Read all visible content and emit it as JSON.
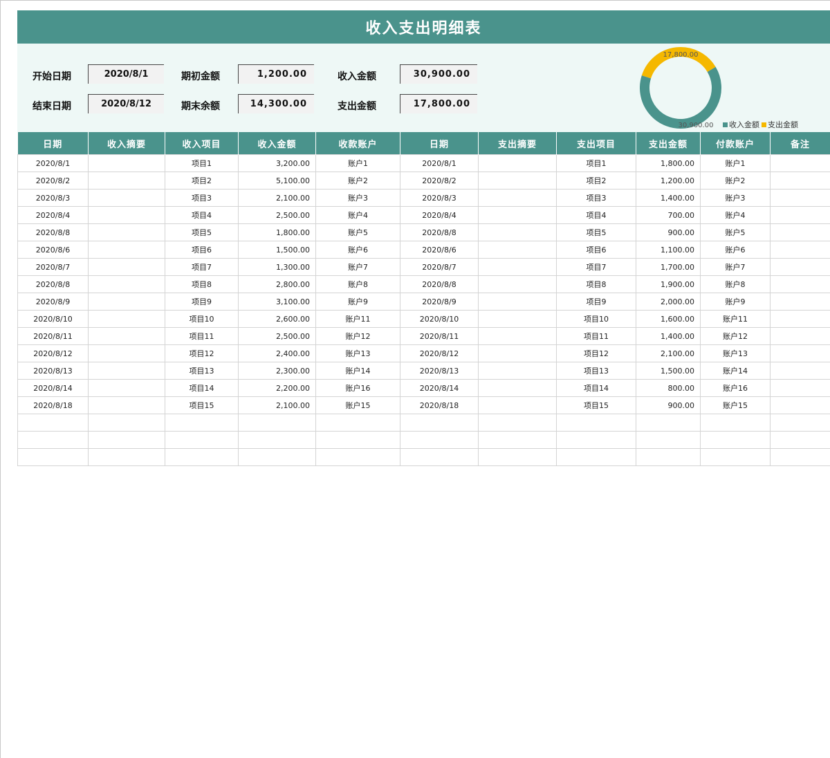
{
  "title": "收入支出明细表",
  "summary": {
    "start_date_label": "开始日期",
    "start_date": "2020/8/1",
    "end_date_label": "结束日期",
    "end_date": "2020/8/12",
    "opening_label": "期初金额",
    "opening_value": "1,200.00",
    "closing_label": "期末余额",
    "closing_value": "14,300.00",
    "income_label": "收入金额",
    "income_value": "30,900.00",
    "expense_label": "支出金额",
    "expense_value": "17,800.00"
  },
  "chart_data": {
    "type": "pie",
    "variant": "donut",
    "categories": [
      "收入金额",
      "支出金额"
    ],
    "values": [
      30900,
      17800
    ],
    "data_labels": [
      "30,900.00",
      "17,800.00"
    ],
    "colors": [
      "#4a938c",
      "#f5b800"
    ],
    "legend": "bottom-right"
  },
  "columns": [
    "日期",
    "收入摘要",
    "收入项目",
    "收入金额",
    "收款账户",
    "日期",
    "支出摘要",
    "支出项目",
    "支出金额",
    "付款账户",
    "备注"
  ],
  "rows": [
    [
      "2020/8/1",
      "",
      "项目1",
      "3,200.00",
      "账户1",
      "2020/8/1",
      "",
      "项目1",
      "1,800.00",
      "账户1",
      ""
    ],
    [
      "2020/8/2",
      "",
      "项目2",
      "5,100.00",
      "账户2",
      "2020/8/2",
      "",
      "项目2",
      "1,200.00",
      "账户2",
      ""
    ],
    [
      "2020/8/3",
      "",
      "项目3",
      "2,100.00",
      "账户3",
      "2020/8/3",
      "",
      "项目3",
      "1,400.00",
      "账户3",
      ""
    ],
    [
      "2020/8/4",
      "",
      "项目4",
      "2,500.00",
      "账户4",
      "2020/8/4",
      "",
      "项目4",
      "700.00",
      "账户4",
      ""
    ],
    [
      "2020/8/8",
      "",
      "项目5",
      "1,800.00",
      "账户5",
      "2020/8/8",
      "",
      "项目5",
      "900.00",
      "账户5",
      ""
    ],
    [
      "2020/8/6",
      "",
      "项目6",
      "1,500.00",
      "账户6",
      "2020/8/6",
      "",
      "项目6",
      "1,100.00",
      "账户6",
      ""
    ],
    [
      "2020/8/7",
      "",
      "项目7",
      "1,300.00",
      "账户7",
      "2020/8/7",
      "",
      "项目7",
      "1,700.00",
      "账户7",
      ""
    ],
    [
      "2020/8/8",
      "",
      "项目8",
      "2,800.00",
      "账户8",
      "2020/8/8",
      "",
      "项目8",
      "1,900.00",
      "账户8",
      ""
    ],
    [
      "2020/8/9",
      "",
      "项目9",
      "3,100.00",
      "账户9",
      "2020/8/9",
      "",
      "项目9",
      "2,000.00",
      "账户9",
      ""
    ],
    [
      "2020/8/10",
      "",
      "项目10",
      "2,600.00",
      "账户11",
      "2020/8/10",
      "",
      "项目10",
      "1,600.00",
      "账户11",
      ""
    ],
    [
      "2020/8/11",
      "",
      "项目11",
      "2,500.00",
      "账户12",
      "2020/8/11",
      "",
      "项目11",
      "1,400.00",
      "账户12",
      ""
    ],
    [
      "2020/8/12",
      "",
      "项目12",
      "2,400.00",
      "账户13",
      "2020/8/12",
      "",
      "项目12",
      "2,100.00",
      "账户13",
      ""
    ],
    [
      "2020/8/13",
      "",
      "项目13",
      "2,300.00",
      "账户14",
      "2020/8/13",
      "",
      "项目13",
      "1,500.00",
      "账户14",
      ""
    ],
    [
      "2020/8/14",
      "",
      "项目14",
      "2,200.00",
      "账户16",
      "2020/8/14",
      "",
      "项目14",
      "800.00",
      "账户16",
      ""
    ],
    [
      "2020/8/18",
      "",
      "项目15",
      "2,100.00",
      "账户15",
      "2020/8/18",
      "",
      "项目15",
      "900.00",
      "账户15",
      ""
    ],
    [
      "",
      "",
      "",
      "",
      "",
      "",
      "",
      "",
      "",
      "",
      ""
    ],
    [
      "",
      "",
      "",
      "",
      "",
      "",
      "",
      "",
      "",
      "",
      ""
    ],
    [
      "",
      "",
      "",
      "",
      "",
      "",
      "",
      "",
      "",
      "",
      ""
    ]
  ]
}
